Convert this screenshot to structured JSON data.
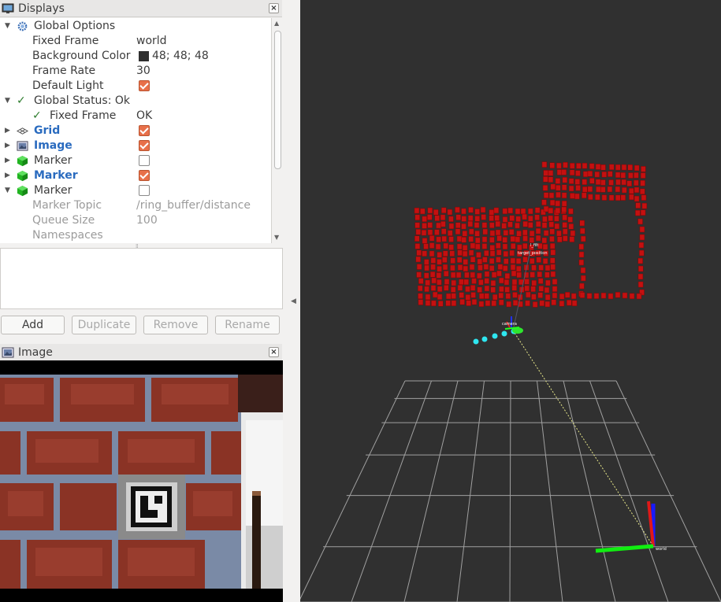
{
  "displays_panel": {
    "title": "Displays",
    "close_icon": "close-icon"
  },
  "tree": {
    "global_options": {
      "label": "Global Options"
    },
    "fixed_frame": {
      "label": "Fixed Frame",
      "value": "world"
    },
    "background_color": {
      "label": "Background Color",
      "value": "48; 48; 48",
      "swatch": "#303030"
    },
    "frame_rate": {
      "label": "Frame Rate",
      "value": "30"
    },
    "default_light": {
      "label": "Default Light",
      "checked": true
    },
    "global_status": {
      "label": "Global Status: Ok"
    },
    "status_fixed_frame": {
      "label": "Fixed Frame",
      "value": "OK"
    },
    "grid": {
      "label": "Grid",
      "checked": true
    },
    "image": {
      "label": "Image",
      "checked": true
    },
    "marker1": {
      "label": "Marker",
      "checked": false
    },
    "marker2": {
      "label": "Marker",
      "checked": true
    },
    "marker3": {
      "label": "Marker",
      "checked": false
    },
    "marker_topic": {
      "label": "Marker Topic",
      "value": "/ring_buffer/distance"
    },
    "queue_size": {
      "label": "Queue Size",
      "value": "100"
    },
    "namespaces": {
      "label": "Namespaces"
    }
  },
  "buttons": {
    "add": "Add",
    "duplicate": "Duplicate",
    "remove": "Remove",
    "rename": "Rename"
  },
  "image_panel": {
    "title": "Image"
  },
  "viewport": {
    "background": "#303030",
    "labels": {
      "frame_label_1": "l_filt",
      "frame_label_2": "target_position",
      "frame_label_3": "camera",
      "frame_label_4": "world"
    }
  },
  "colors": {
    "accent_checkbox": "#e8704a",
    "link_blue": "#2a6bbf",
    "marker_red": "#c41010",
    "marker_cyan": "#2ee6f0"
  }
}
